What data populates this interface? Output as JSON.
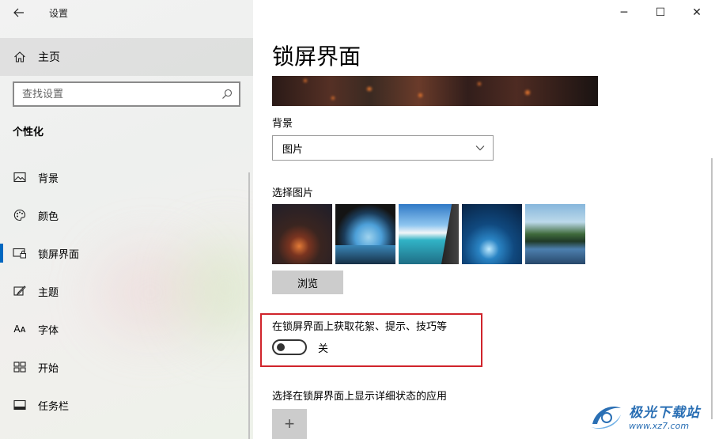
{
  "app": {
    "title": "设置"
  },
  "window_controls": {
    "minimize": "─",
    "maximize": "☐",
    "close": "✕"
  },
  "sidebar": {
    "home_label": "主页",
    "search_placeholder": "查找设置",
    "section_heading": "个性化",
    "items": [
      {
        "label": "背景",
        "icon": "picture-icon"
      },
      {
        "label": "颜色",
        "icon": "palette-icon"
      },
      {
        "label": "锁屏界面",
        "icon": "lock-screen-icon",
        "selected": true
      },
      {
        "label": "主题",
        "icon": "theme-brush-icon"
      },
      {
        "label": "字体",
        "icon": "font-icon",
        "glyph": "Aᴀ"
      },
      {
        "label": "开始",
        "icon": "start-grid-icon"
      },
      {
        "label": "任务栏",
        "icon": "taskbar-icon"
      }
    ]
  },
  "main": {
    "page_title": "锁屏界面",
    "background_label": "背景",
    "background_value": "图片",
    "choose_picture_label": "选择图片",
    "browse_label": "浏览",
    "fun_facts_label": "在锁屏界面上获取花絮、提示、技巧等",
    "fun_facts_state": "关",
    "fun_facts_on": false,
    "detailed_status_label": "选择在锁屏界面上显示详细状态的应用",
    "add_label": "+"
  },
  "watermark": {
    "name": "极光下载站",
    "url": "www.xz7.com"
  },
  "colors": {
    "accent": "#0067c0",
    "highlight_border": "#d0242b",
    "watermark": "#2a6fb4"
  }
}
